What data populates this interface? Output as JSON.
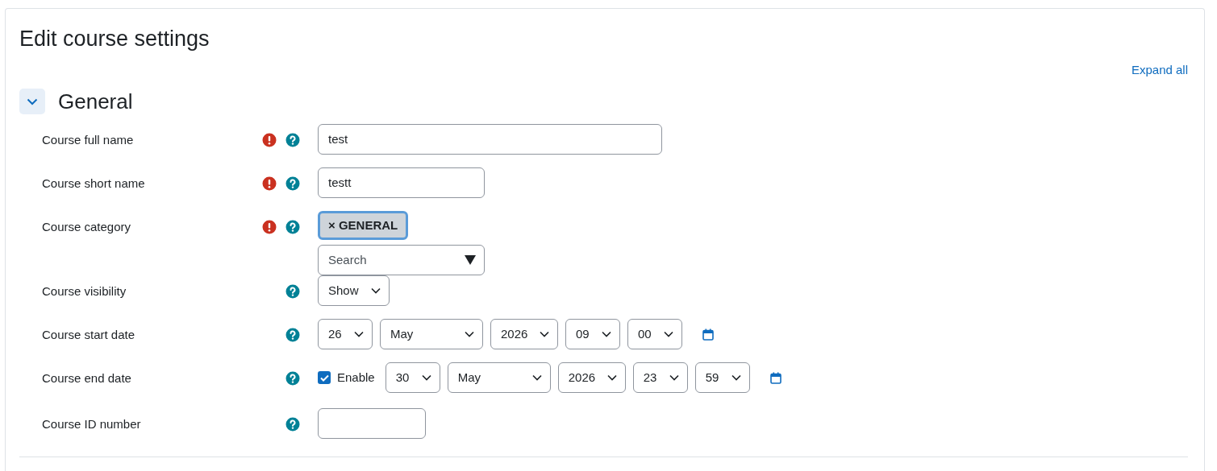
{
  "page_title": "Edit course settings",
  "expand_all": "Expand all",
  "section": {
    "title": "General",
    "expanded": true,
    "fields": [
      {
        "kind": "longtext",
        "label": "Course full name",
        "required": true,
        "value": "test"
      },
      {
        "kind": "text",
        "label": "Course short name",
        "required": true,
        "value": "testt"
      },
      {
        "kind": "autocomplete",
        "label": "Course category",
        "required": true,
        "tags": [
          {
            "remove": "×",
            "label": "GENERAL"
          }
        ],
        "placeholder": "Search"
      },
      {
        "kind": "select",
        "label": "Course visibility",
        "required": false,
        "value": "Show"
      },
      {
        "kind": "date",
        "label": "Course start date",
        "required": false,
        "parts": [
          "26",
          "May",
          "2026",
          "09",
          "00"
        ]
      },
      {
        "kind": "date",
        "label": "Course end date",
        "required": false,
        "enable": {
          "label": "Enable",
          "checked": true
        },
        "parts": [
          "30",
          "May",
          "2026",
          "23",
          "59"
        ]
      },
      {
        "kind": "shorttext",
        "label": "Course ID number",
        "required": false
      }
    ]
  }
}
